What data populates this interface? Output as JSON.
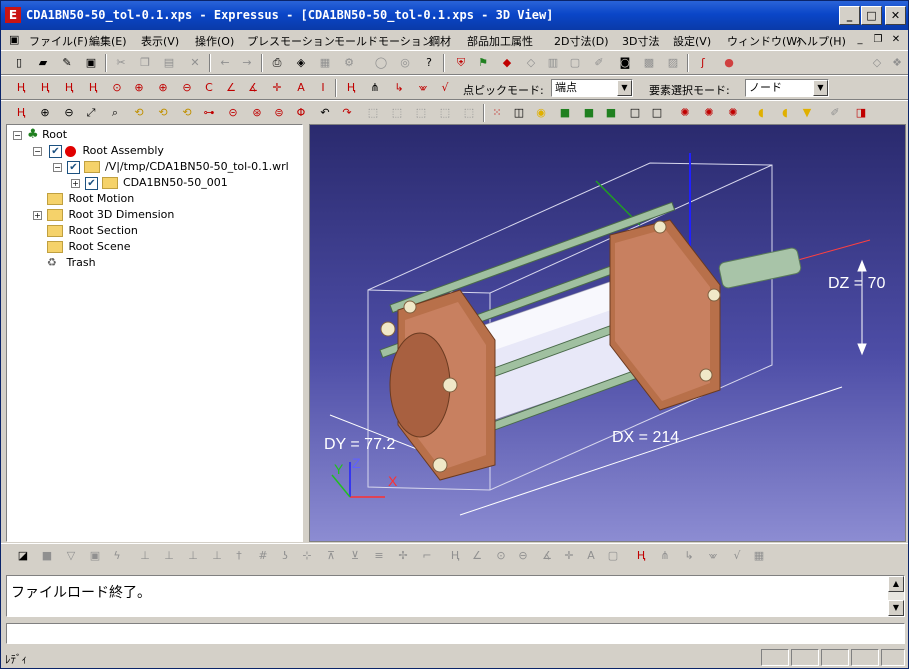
{
  "window": {
    "title": "CDA1BN50-50_tol-0.1.xps - Expressus - [CDA1BN50-50_tol-0.1.xps - 3D View]",
    "app_icon_letter": "E",
    "minimize": "_",
    "maximize": "□",
    "close": "✕"
  },
  "menu": {
    "items": [
      "ファイル(F)",
      "編集(E)",
      "表示(V)",
      "操作(O)",
      "プレスモーション",
      "モールドモーション",
      "鋼材",
      "部品加工属性",
      "2D寸法(D)",
      "3D寸法",
      "設定(V)",
      "ウィンドウ(W)",
      "ヘルプ(H)"
    ],
    "mdi_min": "_",
    "mdi_restore": "❐",
    "mdi_close": "✕"
  },
  "toolbar3": {
    "pick_mode_label": "点ピックモード:",
    "pick_mode_value": "端点",
    "select_mode_label": "要素選択モード:",
    "select_mode_value": "ノード"
  },
  "tree": {
    "root": "Root",
    "assembly": "Root Assembly",
    "file": "/V|/tmp/CDA1BN50-50_tol-0.1.wrl",
    "part": "CDA1BN50-50_001",
    "motion": "Root Motion",
    "dimension": "Root 3D Dimension",
    "section": "Root Section",
    "scene": "Root Scene",
    "trash": "Trash"
  },
  "view3d": {
    "dz": "DZ = 70",
    "dy": "DY = 77.2",
    "dx": "DX = 214",
    "axis_x": "X",
    "axis_y": "Y",
    "axis_z": "Z"
  },
  "output": {
    "message": "ファイルロード終了。"
  },
  "status": {
    "text": "ﾚﾃﾞｨ"
  },
  "colors": {
    "title_bar": "#0a46c8",
    "viewport_top": "#2a2a6e",
    "viewport_bottom": "#8c8cd2",
    "copper": "#b8704a",
    "dimension_text": "#ffffff"
  }
}
